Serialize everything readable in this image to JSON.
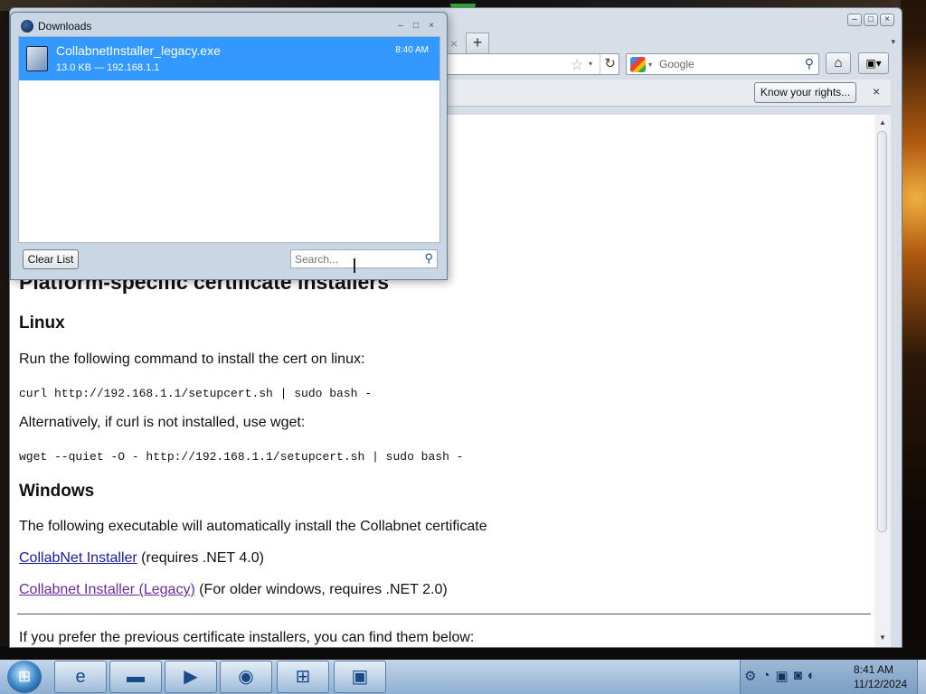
{
  "browser": {
    "tab_close": "×",
    "new_tab": "+",
    "tab_list": "▾",
    "url_star": "☆",
    "url_drop": "▾",
    "reload": "↻",
    "search_placeholder": "Google",
    "search_drop": "▾",
    "search_go": "⚲",
    "home": "⌂",
    "bookmarks": "▣▾",
    "notification": {
      "button_label": "Know your rights...",
      "close": "×"
    },
    "window_controls": [
      "–",
      "□",
      "×"
    ]
  },
  "page": {
    "heading": "Platform-specific certificate installers",
    "linux": {
      "title": "Linux",
      "intro": "Run the following command to install the cert on linux:",
      "cmd1": "curl http://192.168.1.1/setupcert.sh | sudo bash -",
      "alt": "Alternatively, if curl is not installed, use wget:",
      "cmd2": "wget --quiet -O - http://192.168.1.1/setupcert.sh | sudo bash -"
    },
    "windows": {
      "title": "Windows",
      "intro": "The following executable will automatically install the Collabnet certificate",
      "link1": "CollabNet Installer",
      "link1_note": " (requires .NET 4.0)",
      "link2": "Collabnet Installer (Legacy)",
      "link2_note": " (For older windows, requires .NET 2.0)"
    },
    "footer_text": "If you prefer the previous certificate installers, you can find them below:"
  },
  "downloads": {
    "title": "Downloads",
    "window_controls": [
      "–",
      "□",
      "×"
    ],
    "items": [
      {
        "name": "CollabnetInstaller_legacy.exe",
        "meta": "13.0 KB — 192.168.1.1",
        "time": "8:40 AM"
      }
    ],
    "clear_label": "Clear List",
    "search_placeholder": "Search...",
    "search_icon": "⚲"
  },
  "taskbar": {
    "start": "⊞",
    "buttons": [
      "e",
      "▬",
      "▶",
      "◉",
      "⊞",
      "▣"
    ],
    "tray_icons": [
      "⚙",
      "◔",
      "▣",
      "◙",
      "◐"
    ],
    "clock_time": "8:41 AM",
    "clock_date": "11/12/2024"
  },
  "colors": {
    "selection": "#3399ff",
    "link": "#1a1aa6",
    "link_visited": "#6b2aa0"
  }
}
